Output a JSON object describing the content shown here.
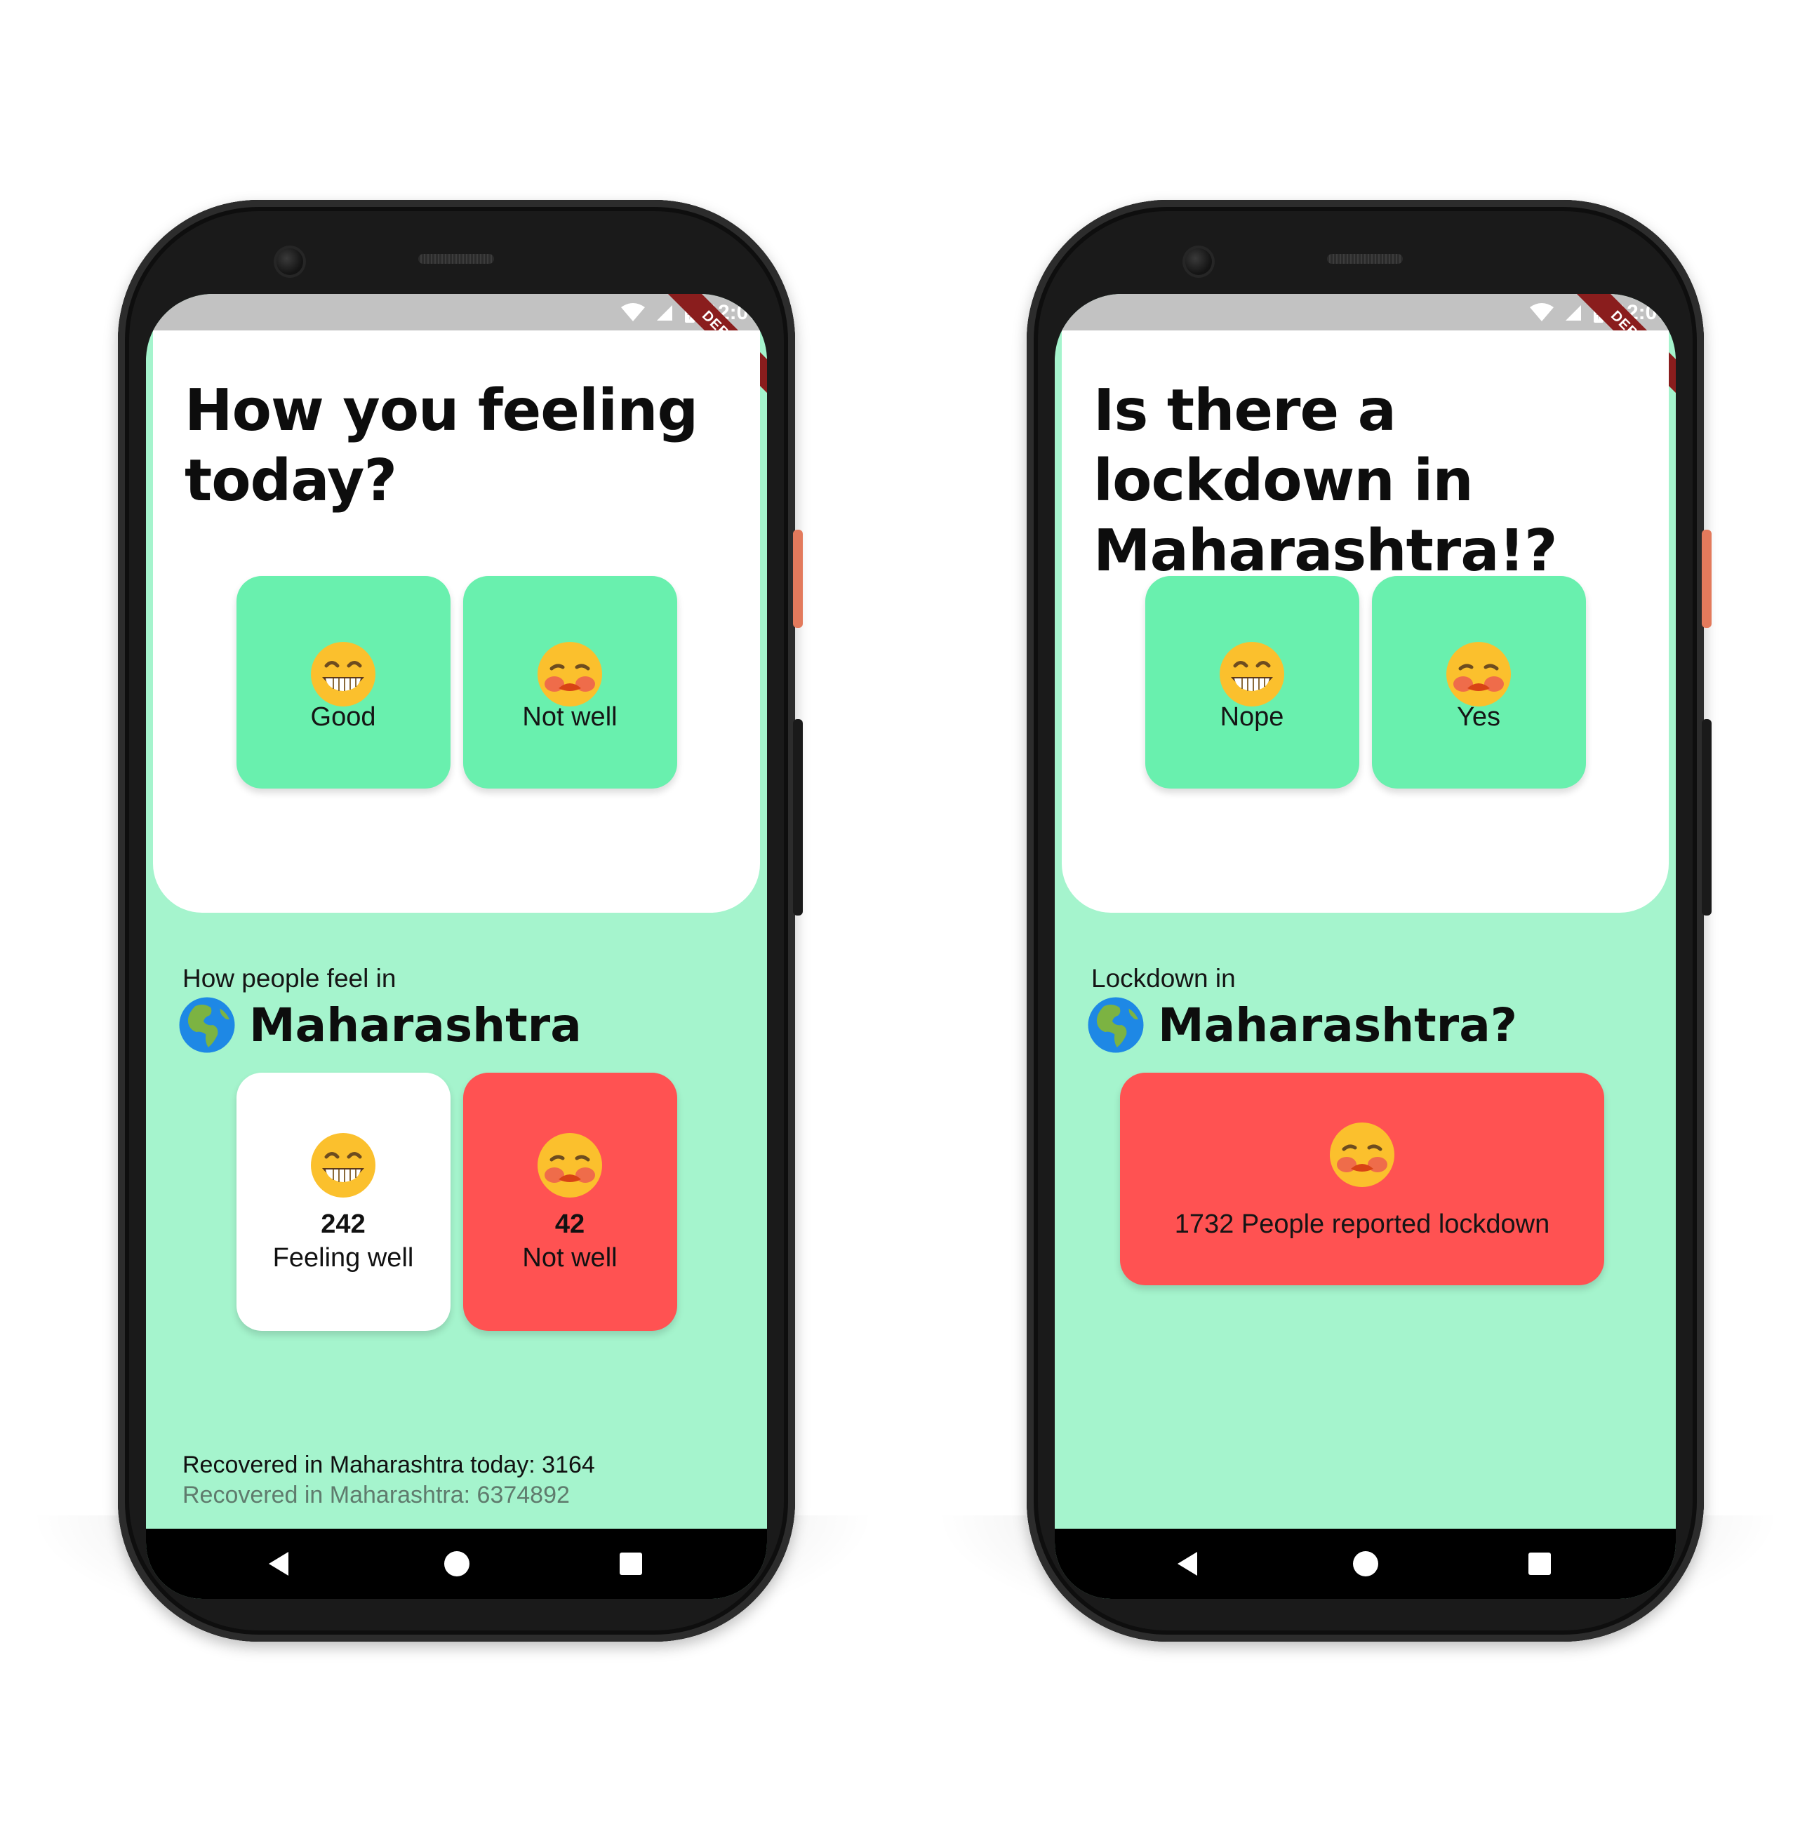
{
  "colors": {
    "accent_green": "#69f0ae",
    "background_mint": "#a5f4cd",
    "alert_red": "#ff5252",
    "card_white": "#ffffff"
  },
  "phones": [
    {
      "status": {
        "time": "12:07",
        "debug_banner": "DEBUG"
      },
      "question": "How you feeling today?",
      "choices": [
        {
          "icon": "grinning-face-icon",
          "label": "Good"
        },
        {
          "icon": "worried-face-icon",
          "label": "Not well"
        }
      ],
      "section": {
        "subtitle": "How people feel in",
        "region_icon": "globe-icon",
        "region": "Maharashtra"
      },
      "stats": [
        {
          "icon": "grinning-face-icon",
          "count": "242",
          "label": "Feeling well",
          "color": "#ffffff"
        },
        {
          "icon": "worried-face-icon",
          "count": "42",
          "label": "Not well",
          "color": "#ff5252"
        }
      ],
      "recovered_today": "Recovered in Maharashtra today: 3164",
      "recovered_total": "Recovered in Maharashtra: 6374892"
    },
    {
      "status": {
        "time": "12:07",
        "debug_banner": "DEBUG"
      },
      "question": "Is there a lockdown in Maharashtra!?",
      "choices": [
        {
          "icon": "grinning-face-icon",
          "label": "Nope"
        },
        {
          "icon": "worried-face-icon",
          "label": "Yes"
        }
      ],
      "section": {
        "subtitle": "Lockdown in",
        "region_icon": "globe-icon",
        "region": "Maharashtra?"
      },
      "report": {
        "icon": "worried-face-icon",
        "label": "1732 People reported lockdown",
        "color": "#ff5252"
      }
    }
  ]
}
